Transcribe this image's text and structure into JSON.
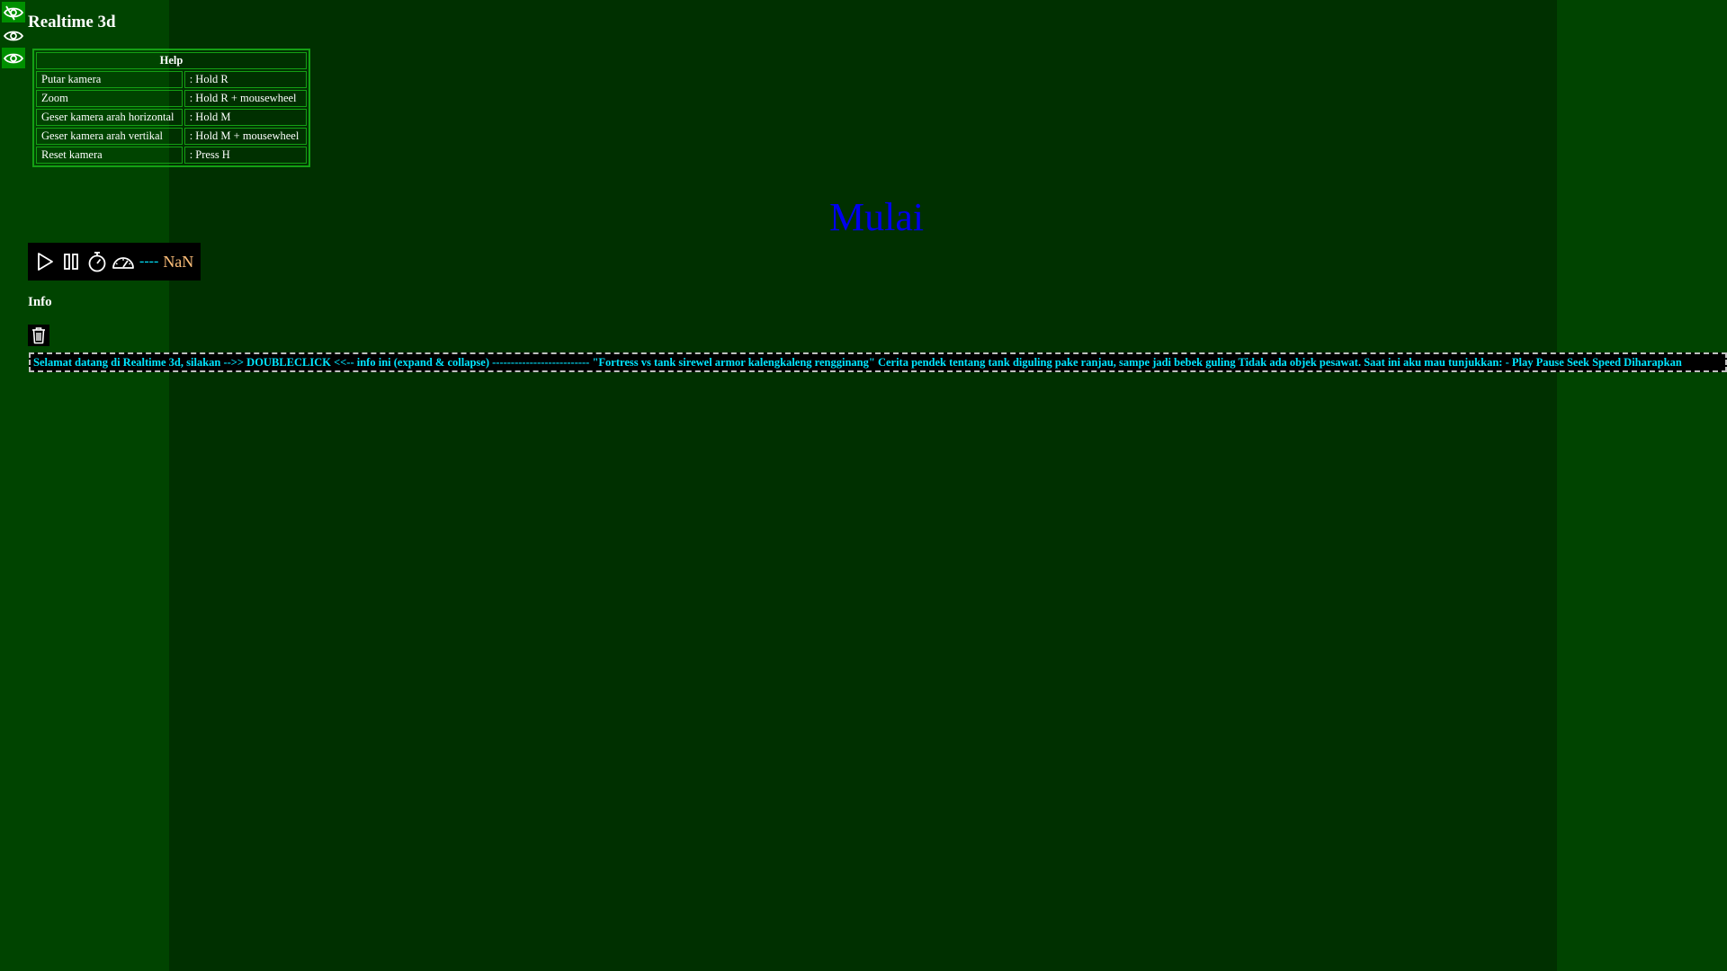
{
  "app": {
    "title": "Realtime 3d"
  },
  "sidebar": {
    "buttons": [
      {
        "icon": "eye-slash-icon",
        "active": true
      },
      {
        "icon": "eye-icon",
        "active": false
      },
      {
        "icon": "eye-icon",
        "active": true
      }
    ]
  },
  "help": {
    "title": "Help",
    "rows": [
      {
        "action": "Putar kamera",
        "key": ": Hold R"
      },
      {
        "action": "Zoom",
        "key": ": Hold R + mousewheel"
      },
      {
        "action": "Geser kamera arah horizontal",
        "key": ": Hold M"
      },
      {
        "action": "Geser kamera arah vertikal",
        "key": ": Hold M + mousewheel"
      },
      {
        "action": "Reset kamera",
        "key": ": Press H"
      }
    ]
  },
  "start": {
    "label": "Mulai"
  },
  "player": {
    "icons": [
      "play-icon",
      "pause-icon",
      "stopwatch-icon",
      "speedometer-icon"
    ],
    "speed_separator": "----",
    "speed_value": "NaN"
  },
  "info": {
    "title": "Info",
    "text": "Selamat datang di Realtime 3d, silakan -->> DOUBLECLICK <<-- info ini (expand & collapse) -------------------------- \"Fortress vs tank sirewel armor kalengkaleng rengginang\" Cerita pendek tentang tank diguling pake ranjau, sampe jadi bebek guling Tidak ada objek pesawat. Saat ini aku mau tunjukkan: - Play Pause Seek Speed Diharapkan"
  },
  "colors": {
    "background": "#003000",
    "side_columns": "#004400",
    "accent_green": "#009000",
    "table_border": "#14a014",
    "start_link": "#0000ee",
    "speed_separator": "#00e5ff",
    "speed_value": "#ffc07a",
    "info_text": "#00e5ff"
  }
}
